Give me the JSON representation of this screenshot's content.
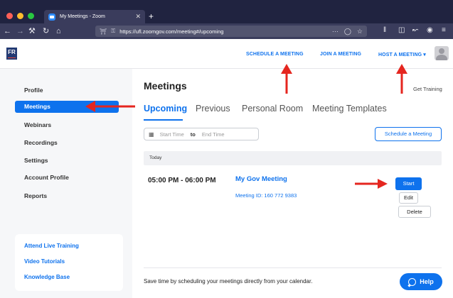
{
  "browser": {
    "tab_title": "My Meetings - Zoom",
    "tab_close": "✕",
    "new_tab": "+",
    "url": "https://ufl.zoomgov.com/meeting#/upcoming",
    "url_more": "···"
  },
  "header": {
    "logo_text": "FR",
    "links": {
      "schedule": "SCHEDULE A MEETING",
      "join": "JOIN A MEETING",
      "host": "HOST A MEETING ▾"
    }
  },
  "sidebar": {
    "items": [
      {
        "label": "Profile"
      },
      {
        "label": "Meetings"
      },
      {
        "label": "Webinars"
      },
      {
        "label": "Recordings"
      },
      {
        "label": "Settings"
      },
      {
        "label": "Account Profile"
      },
      {
        "label": "Reports"
      }
    ],
    "active_item": "Meetings",
    "help_links": [
      "Attend Live Training",
      "Video Tutorials",
      "Knowledge Base"
    ]
  },
  "main": {
    "title": "Meetings",
    "get_training": "Get Training",
    "tabs": [
      {
        "label": "Upcoming"
      },
      {
        "label": "Previous"
      },
      {
        "label": "Personal Room"
      },
      {
        "label": "Meeting Templates"
      }
    ],
    "active_tab": "Upcoming",
    "date_filter": {
      "start_placeholder": "Start Time",
      "to_label": "to",
      "end_placeholder": "End Time"
    },
    "schedule_button": "Schedule a Meeting",
    "group_label": "Today",
    "meeting": {
      "time": "05:00 PM - 06:00 PM",
      "title": "My Gov Meeting",
      "meeting_id": "Meeting ID: 160 772 9383",
      "start_label": "Start",
      "edit_label": "Edit",
      "delete_label": "Delete"
    },
    "footer_text": "Save time by scheduling your meetings directly from your calendar.",
    "help_button": "Help"
  },
  "colors": {
    "accent": "#0e72ed",
    "annotation_arrow": "#e5261f",
    "browser_chrome": "#3a3c5c"
  }
}
